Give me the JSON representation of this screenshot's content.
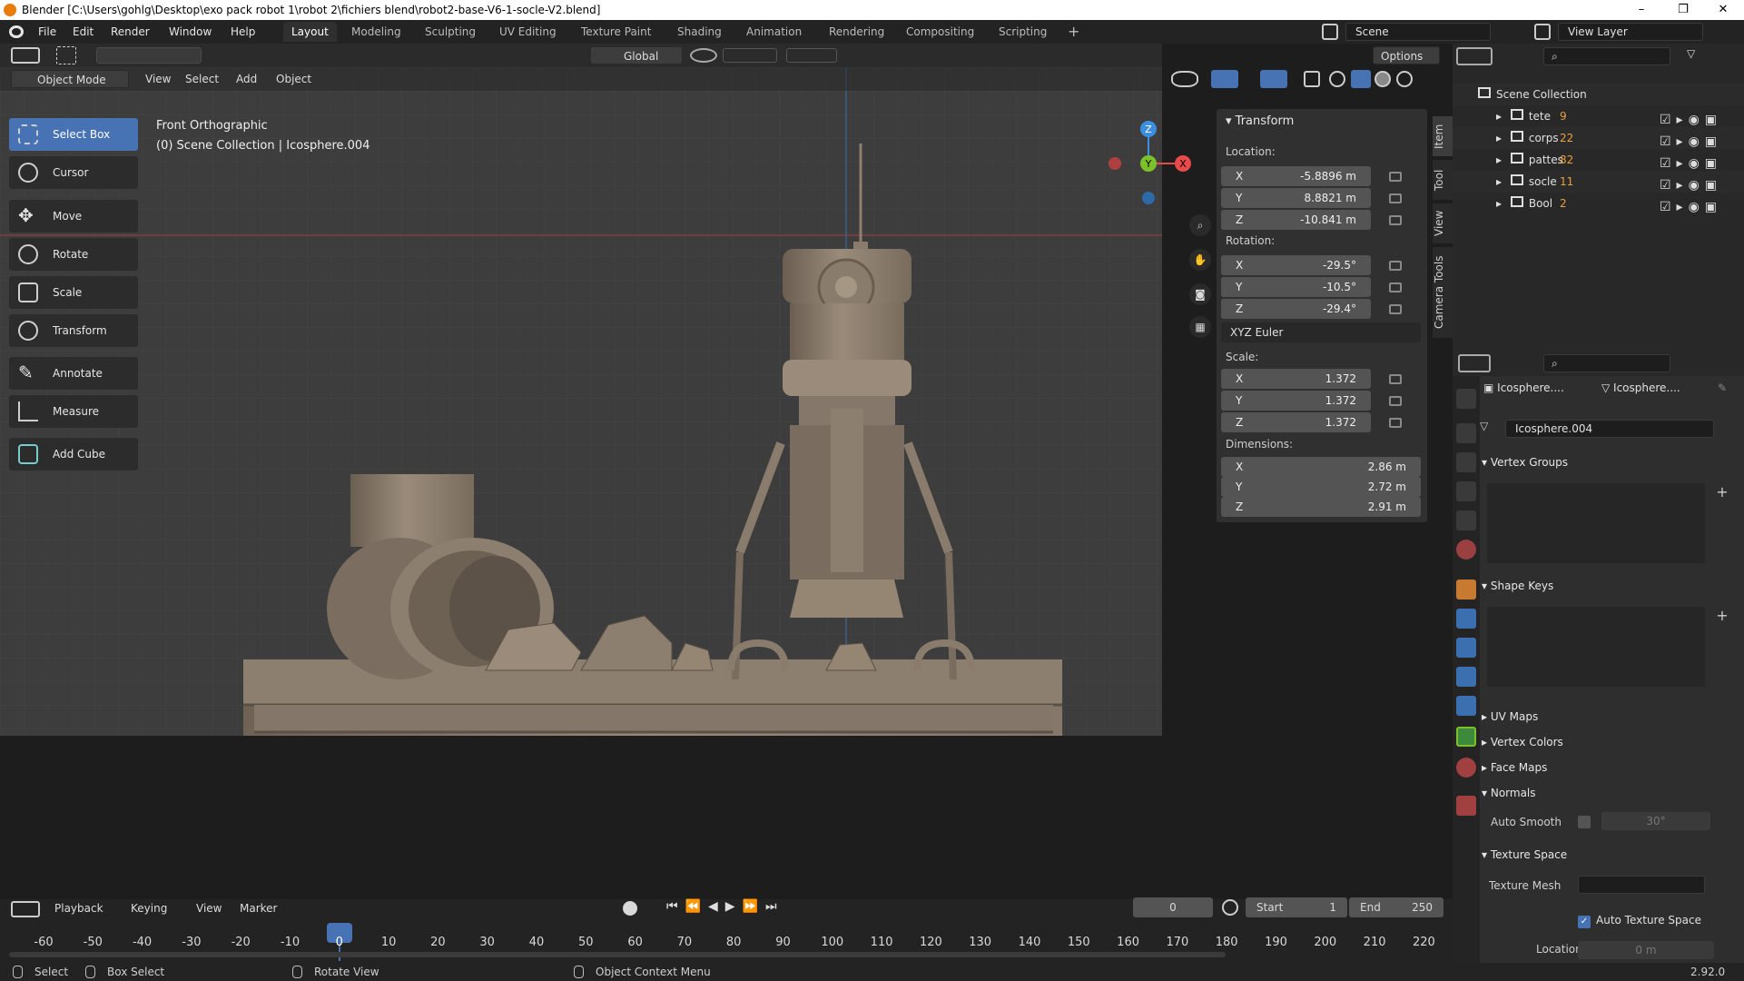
{
  "window": {
    "title": "Blender [C:\\Users\\gohlg\\Desktop\\exo pack robot 1\\robot 2\\fichiers blend\\robot2-base-V6-1-socle-V2.blend]",
    "minimize": "–",
    "maximize": "❐",
    "close": "✕"
  },
  "menu": {
    "file": "File",
    "edit": "Edit",
    "render": "Render",
    "window": "Window",
    "help": "Help"
  },
  "workspaces": [
    "Layout",
    "Modeling",
    "Sculpting",
    "UV Editing",
    "Texture Paint",
    "Shading",
    "Animation",
    "Rendering",
    "Compositing",
    "Scripting"
  ],
  "add_workspace": "+",
  "scene": {
    "name": "Scene",
    "view_layer": "View Layer"
  },
  "viewport": {
    "mode": "Object Mode",
    "menus": [
      "View",
      "Select",
      "Add",
      "Object"
    ],
    "transform_orientation": "Global",
    "options": "Options",
    "view_name": "Front Orthographic",
    "collection_info": "(0) Scene Collection | Icosphere.004",
    "gizmo": {
      "z": "Z",
      "y": "Y",
      "x": "X"
    }
  },
  "tools": [
    "Select Box",
    "Cursor",
    "Move",
    "Rotate",
    "Scale",
    "Transform",
    "Annotate",
    "Measure",
    "Add Cube"
  ],
  "transform": {
    "header": "Transform",
    "location_label": "Location:",
    "location": {
      "x": "-5.8896 m",
      "y": "8.8821 m",
      "z": "-10.841 m"
    },
    "rotation_label": "Rotation:",
    "rotation": {
      "x": "-29.5°",
      "y": "-10.5°",
      "z": "-29.4°"
    },
    "rotation_mode": "XYZ Euler",
    "scale_label": "Scale:",
    "scale": {
      "x": "1.372",
      "y": "1.372",
      "z": "1.372"
    },
    "dimensions_label": "Dimensions:",
    "dimensions": {
      "x": "2.86 m",
      "y": "2.72 m",
      "z": "2.91 m"
    },
    "axes": {
      "x": "X",
      "y": "Y",
      "z": "Z"
    }
  },
  "sidebar_tabs": [
    "Item",
    "Tool",
    "View",
    "Camera Tools"
  ],
  "outliner": {
    "root": "Scene Collection",
    "items": [
      {
        "name": "tete",
        "count": "9"
      },
      {
        "name": "corps",
        "count": "22"
      },
      {
        "name": "pattes",
        "count": "82"
      },
      {
        "name": "socle",
        "count": "11"
      },
      {
        "name": "Bool",
        "count": "2"
      }
    ]
  },
  "properties": {
    "object_tab": "Icosphere....",
    "mesh_tab": "Icosphere....",
    "mesh_name": "Icosphere.004",
    "vertex_groups": "Vertex Groups",
    "shape_keys": "Shape Keys",
    "uv_maps": "UV Maps",
    "vertex_colors": "Vertex Colors",
    "face_maps": "Face Maps",
    "normals": "Normals",
    "auto_smooth": "Auto Smooth",
    "auto_smooth_angle": "30°",
    "texture_space": "Texture Space",
    "texture_mesh": "Texture Mesh",
    "auto_texture_space": "Auto Texture Space",
    "location_x": "Location X",
    "location_x_value": "0 m"
  },
  "timeline": {
    "playback": "Playback",
    "keying": "Keying",
    "view": "View",
    "marker": "Marker",
    "current_frame": "0",
    "start_label": "Start",
    "start": "1",
    "end_label": "End",
    "end": "250",
    "ticks": [
      "-60",
      "-50",
      "-40",
      "-30",
      "-20",
      "-10",
      "0",
      "10",
      "20",
      "30",
      "40",
      "50",
      "60",
      "70",
      "80",
      "90",
      "100",
      "110",
      "120",
      "130",
      "140",
      "150",
      "160",
      "170",
      "180",
      "190",
      "200",
      "210",
      "220"
    ]
  },
  "status": {
    "select": "Select",
    "box_select": "Box Select",
    "rotate_view": "Rotate View",
    "context_menu": "Object Context Menu",
    "version": "2.92.0"
  },
  "colors": {
    "accent": "#4772b3",
    "x_axis": "#e84a4a",
    "y_axis": "#7cc02a",
    "z_axis": "#3c8fe0",
    "object": "#877968"
  }
}
